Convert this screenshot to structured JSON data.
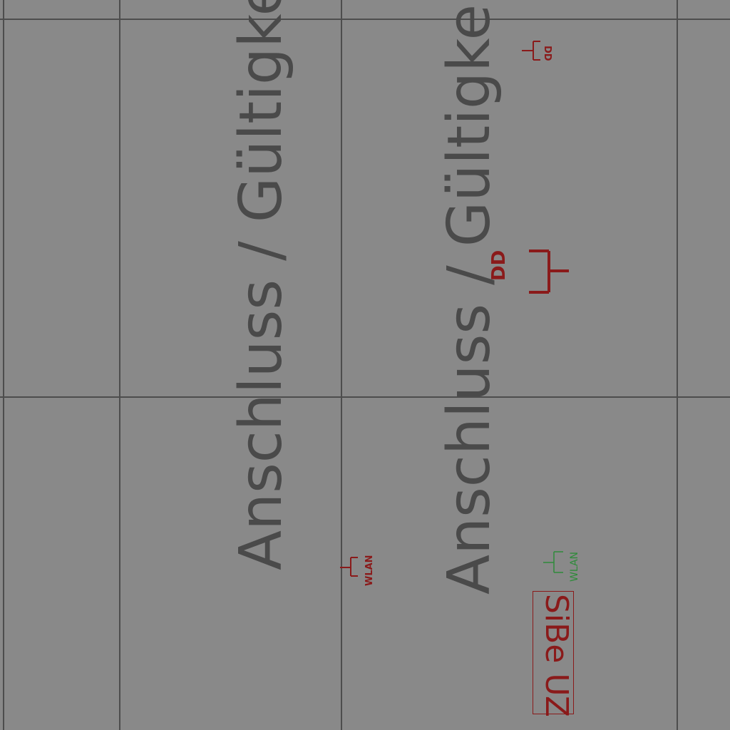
{
  "labels": {
    "column_label_1": "Anschluss / Gültigkeit",
    "column_label_2": "Anschluss / Gültigkeit"
  },
  "symbols": {
    "data_outlet_small": "DD",
    "data_outlet_large": "DD",
    "wlan_red": "WLAN",
    "wlan_green": "WLAN",
    "sibe_uz": "SiBe UZ"
  },
  "colors": {
    "background": "#898989",
    "grid": "#4d4d4d",
    "label": "#4a4a4a",
    "symbol_red": "#8a1a1a",
    "symbol_green": "#2e8b3a"
  },
  "icons": [
    "data-outlet-icon",
    "wlan-access-point-icon"
  ]
}
